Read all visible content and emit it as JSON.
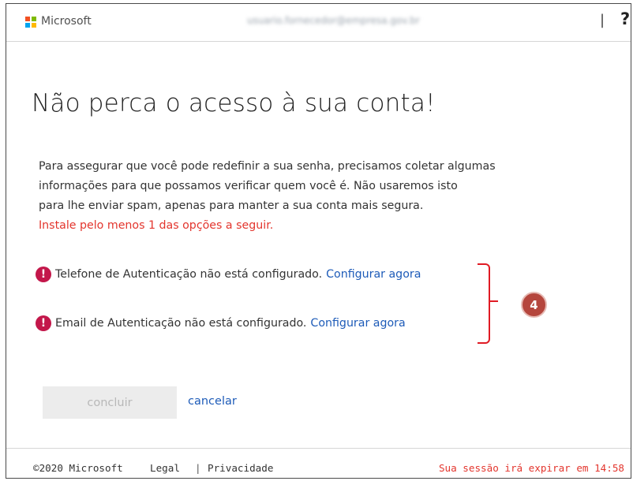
{
  "header": {
    "brand": "Microsoft",
    "account": "usuario.fornecedor@empresa.gov.br",
    "separator": "|",
    "help": "?"
  },
  "main": {
    "title": "Não perca o acesso à sua conta!",
    "description_lines": [
      "Para assegurar que você pode redefinir a sua senha, precisamos coletar algumas",
      "informações para que possamos verificar quem você é. Não usaremos isto",
      "para lhe enviar spam, apenas para manter a sua conta mais segura."
    ],
    "warning": "Instale pelo menos 1 das opções a seguir.",
    "options": [
      {
        "icon": "!",
        "text": "Telefone de Autenticação não está configurado.",
        "link": "Configurar agora"
      },
      {
        "icon": "!",
        "text": "Email de Autenticação não está configurado.",
        "link": "Configurar agora"
      }
    ],
    "annotation_badge": "4",
    "buttons": {
      "done": "concluir",
      "cancel": "cancelar"
    }
  },
  "footer": {
    "copyright": "©2020 Microsoft",
    "legal": "Legal",
    "separator": "|",
    "privacy": "Privacidade",
    "session": "Sua sessão irá expirar em 14:58"
  },
  "colors": {
    "warning_red": "#e3352d",
    "link_blue": "#1d5bb8",
    "error_icon": "#c3174a",
    "badge": "#b5463d"
  }
}
